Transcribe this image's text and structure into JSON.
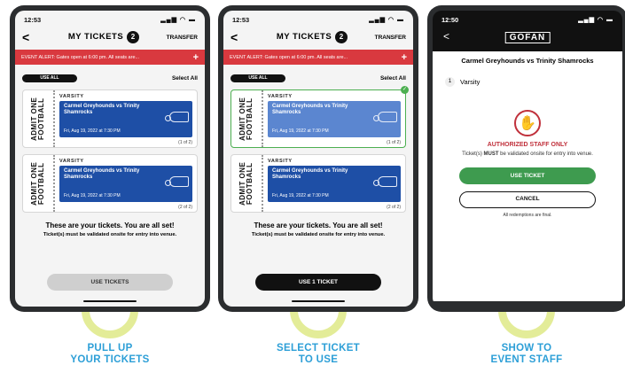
{
  "status_bar": {
    "p1_time": "12:53",
    "p2_time": "12:53",
    "p3_time": "12:50",
    "system_icons": "▂▄▆ ◠ ▬"
  },
  "nav": {
    "back": "<",
    "title": "MY TICKETS",
    "count": "2",
    "transfer": "TRANSFER"
  },
  "alert": {
    "p1_text": "EVENT ALERT: Gates open at 6:00 pm. All seats are...",
    "p2_text": "EVENT ALERT: Gates open at 6:00 pm. All seats are...",
    "plus": "+"
  },
  "select": {
    "use_all": "USE ALL",
    "select_all": "Select All"
  },
  "ticket_common": {
    "stub_text": "ADMIT ONE FOOTBALL",
    "label": "VARSITY",
    "event": "Carmel Greyhounds vs Trinity Shamrocks",
    "date": "Fri, Aug 19, 2022 at 7:30 PM"
  },
  "tickets": [
    {
      "page": "(1 of 2)",
      "selected_in_step2": true
    },
    {
      "page": "(2 of 2)",
      "selected_in_step2": false
    }
  ],
  "message": {
    "big": "These are your tickets. You are all set!",
    "small": "Ticket(s) must be validated onsite for entry into venue."
  },
  "buttons": {
    "use_tickets": "USE TICKETS",
    "use_1_ticket": "USE 1 TICKET"
  },
  "detail": {
    "logo": "GOFAN",
    "back": "<",
    "title": "Carmel Greyhounds vs Trinity Shamrocks",
    "ticket_num": "1",
    "ticket_level": "Varsity",
    "authorized": "AUTHORIZED STAFF ONLY",
    "note_pre": "Ticket(s) ",
    "note_must": "MUST",
    "note_post": " be validated onsite for entry into venue.",
    "use_ticket": "USE TICKET",
    "cancel": "CANCEL",
    "final": "All redemptions are final."
  },
  "captions": {
    "step1": "PULL UP\nYOUR TICKETS",
    "step2": "SELECT TICKET\nTO USE",
    "step3": "SHOW TO\nEVENT STAFF"
  },
  "colors": {
    "accent_blue": "#2d9fd7",
    "alert_red": "#d9393f",
    "staff_red": "#c0303b",
    "use_green": "#3e9b4f",
    "ring_yellow": "#e3ec98"
  }
}
